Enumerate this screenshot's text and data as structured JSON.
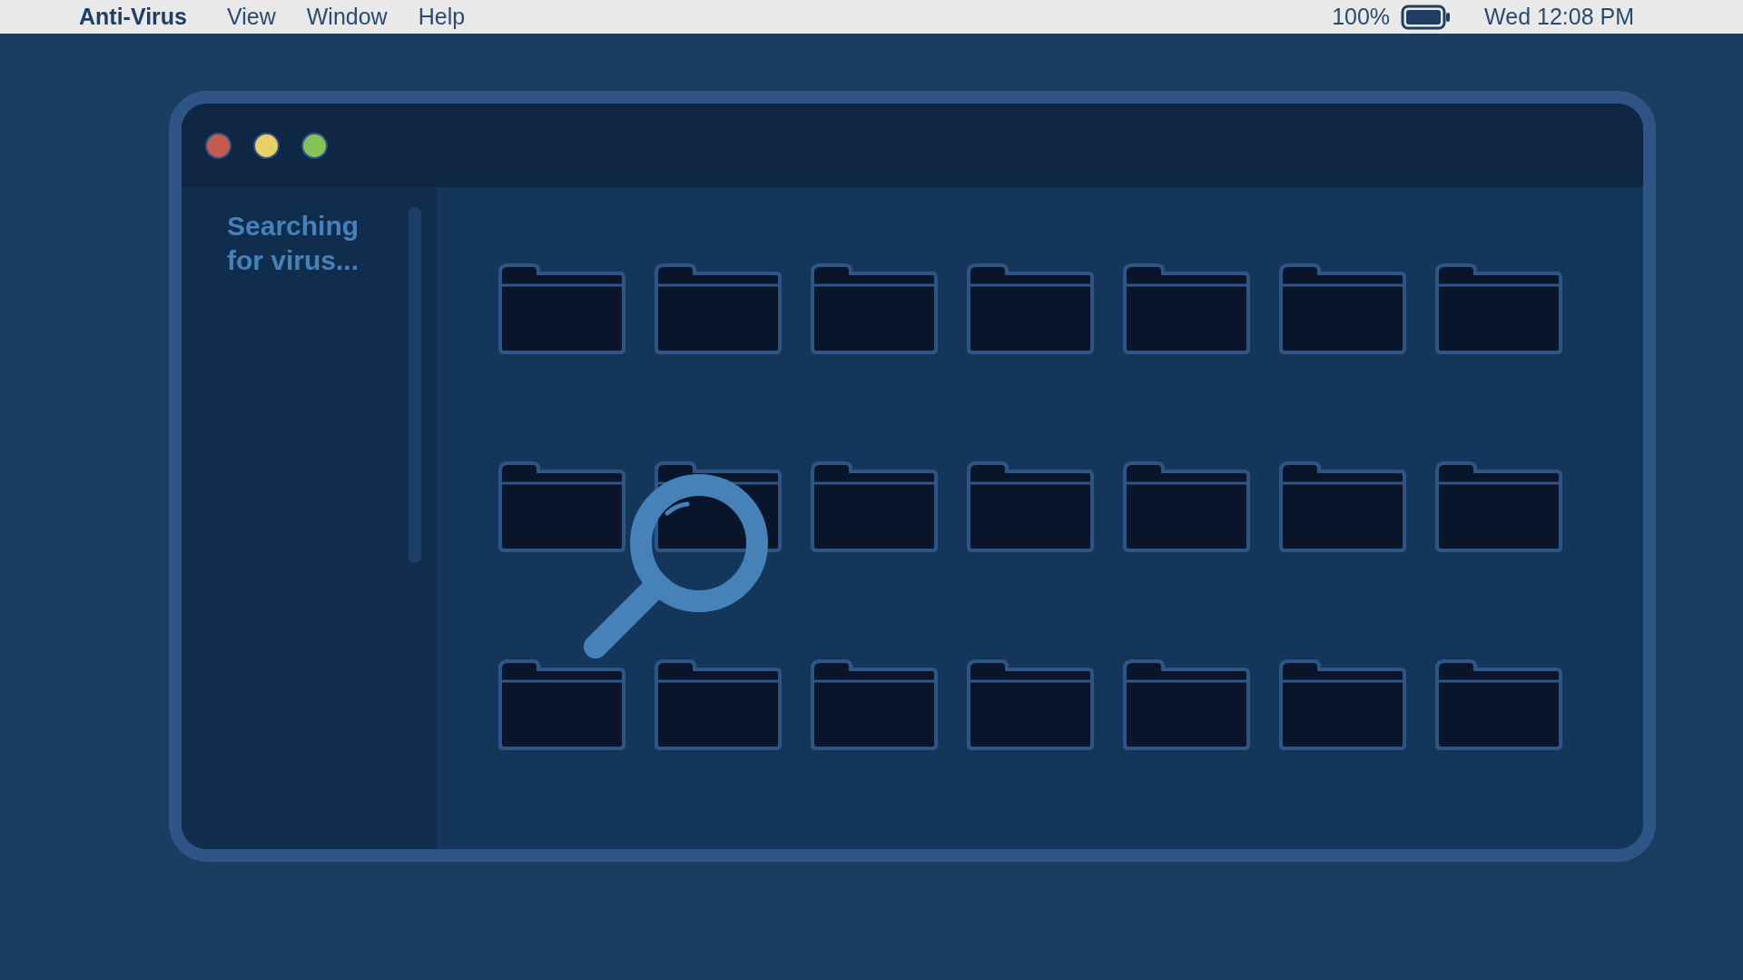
{
  "menu_bar": {
    "app_name": "Anti-Virus",
    "items": [
      "View",
      "Window",
      "Help"
    ],
    "battery_percent": "100%",
    "clock": "Wed 12:08 PM"
  },
  "window": {
    "controls": [
      {
        "color": "#c45c52"
      },
      {
        "color": "#e8cf6a"
      },
      {
        "color": "#86c257"
      }
    ],
    "sidebar": {
      "status": "Searching for virus..."
    }
  }
}
